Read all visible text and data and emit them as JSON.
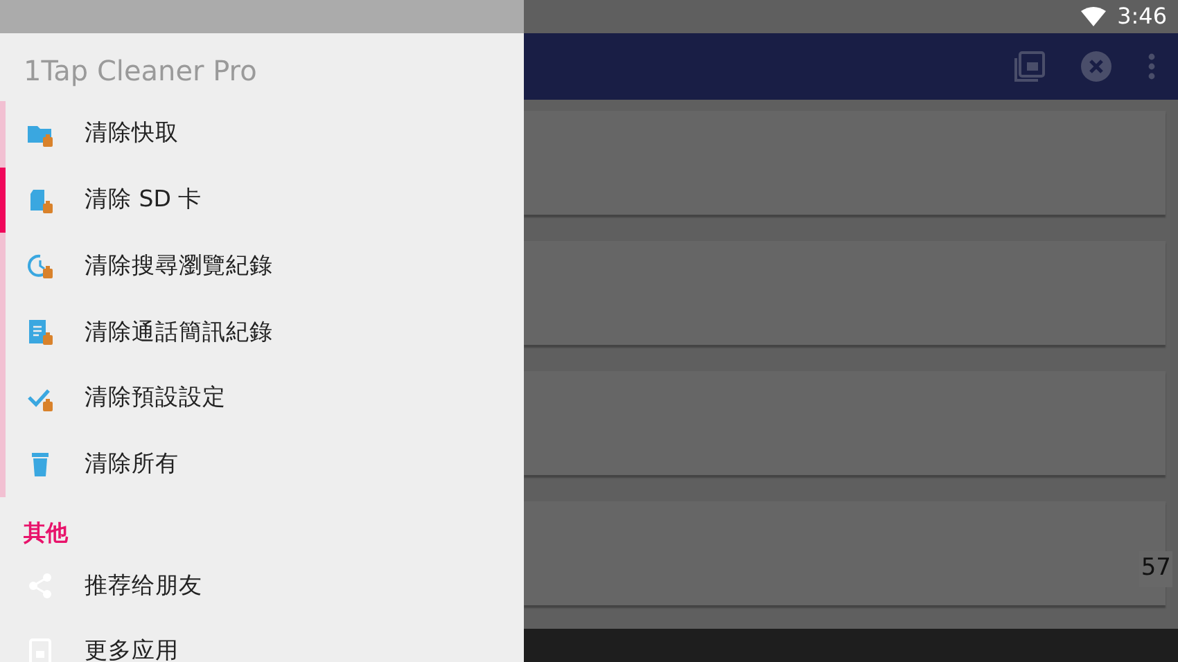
{
  "status_bar": {
    "time": "3:46"
  },
  "drawer": {
    "title": "1Tap Cleaner Pro",
    "items": [
      {
        "kind": "folder",
        "label": "清除快取",
        "selected": false
      },
      {
        "kind": "sdcard",
        "label": "清除 SD 卡",
        "selected": true
      },
      {
        "kind": "history",
        "label": "清除搜尋瀏覽紀錄",
        "selected": false
      },
      {
        "kind": "document",
        "label": "清除通話簡訊紀錄",
        "selected": false
      },
      {
        "kind": "check",
        "label": "清除預設設定",
        "selected": false
      },
      {
        "kind": "trash",
        "label": "清除所有",
        "selected": false
      }
    ],
    "section": {
      "title": "其他",
      "items": [
        {
          "kind": "share",
          "label": "推荐给朋友"
        },
        {
          "kind": "apps",
          "label": "更多应用"
        }
      ]
    }
  },
  "content": {
    "counter": "57"
  }
}
